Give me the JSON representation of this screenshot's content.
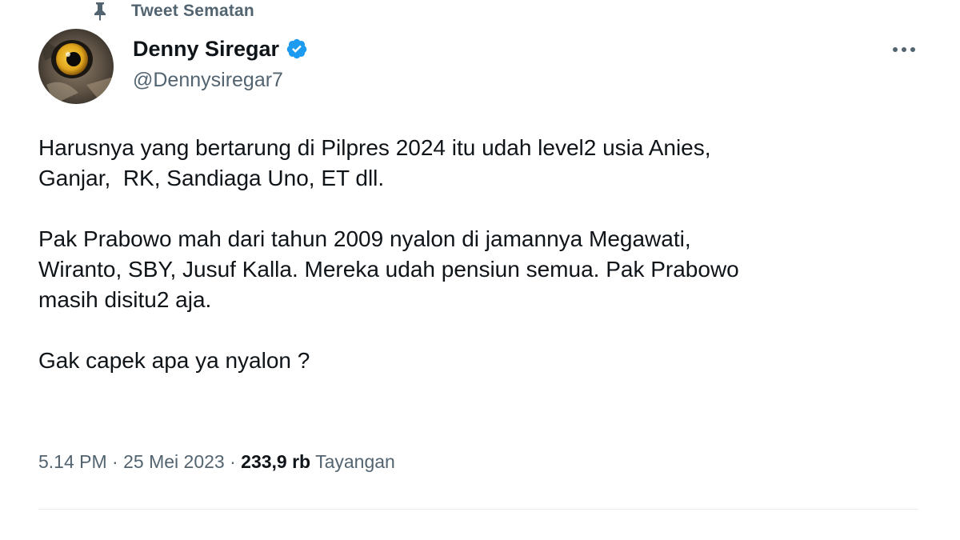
{
  "pinned": {
    "label": "Tweet Sematan",
    "icon": "pin-icon"
  },
  "author": {
    "display_name": "Denny Siregar",
    "handle": "@Dennysiregar7",
    "verified": true,
    "verified_color": "#1d9bf0",
    "avatar": "owl-eye-avatar"
  },
  "tweet": {
    "paragraphs": [
      "Harusnya yang bertarung di Pilpres 2024 itu udah level2 usia Anies,\nGanjar,  RK, Sandiaga Uno, ET dll.",
      "Pak Prabowo mah dari tahun 2009 nyalon di jamannya Megawati,\nWiranto, SBY, Jusuf Kalla. Mereka udah pensiun semua. Pak Prabowo\nmasih disitu2 aja.",
      "Gak capek apa ya nyalon ?"
    ]
  },
  "meta": {
    "time": "5.14 PM",
    "separator": " · ",
    "date": "25 Mei 2023",
    "views_count": "233,9 rb",
    "views_label": " Tayangan"
  },
  "colors": {
    "text": "#0f1419",
    "secondary": "#536471",
    "border": "#e7e9ea",
    "accent": "#1d9bf0"
  }
}
